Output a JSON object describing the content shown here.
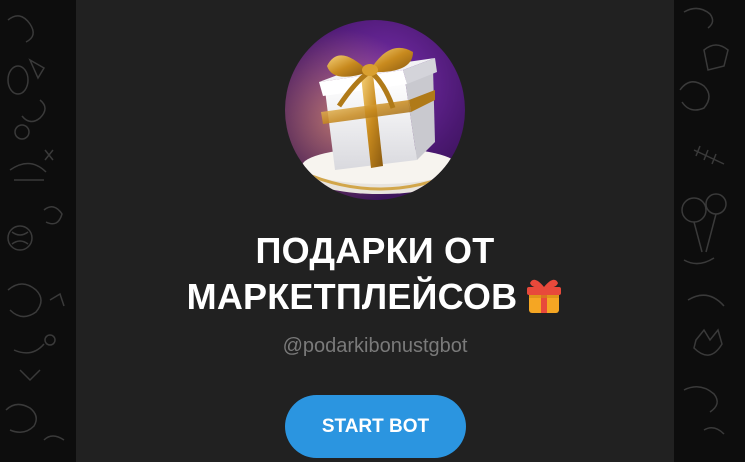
{
  "bot": {
    "name_line1": "ПОДАРКИ ОТ",
    "name_line2": "МАРКЕТПЛЕЙСОВ",
    "name_emoji": "gift-emoji-icon",
    "username": "@podarkibonustgbot",
    "start_label": "START BOT",
    "avatar": "gift-box-avatar"
  },
  "colors": {
    "background": "#0d0d0d",
    "card": "#212121",
    "accent": "#2b95e0",
    "username": "#7a7a7a"
  }
}
